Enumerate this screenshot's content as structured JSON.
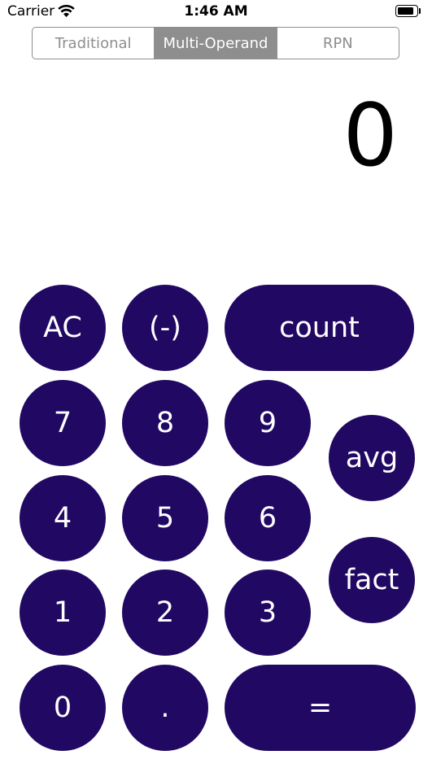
{
  "status_bar": {
    "carrier": "Carrier",
    "time": "1:46 AM",
    "wifi_icon": "wifi-icon",
    "battery_icon": "battery-icon"
  },
  "mode_selector": {
    "segments": [
      {
        "label": "Traditional",
        "selected": false
      },
      {
        "label": "Multi-Operand",
        "selected": true
      },
      {
        "label": "RPN",
        "selected": false
      }
    ]
  },
  "display": {
    "value": "0"
  },
  "keys": {
    "ac": "AC",
    "negate": "(-)",
    "count": "count",
    "seven": "7",
    "eight": "8",
    "nine": "9",
    "avg": "avg",
    "four": "4",
    "five": "5",
    "six": "6",
    "fact": "fact",
    "one": "1",
    "two": "2",
    "three": "3",
    "zero": "0",
    "decimal": ".",
    "equals": "="
  },
  "colors": {
    "key_background": "#210963",
    "key_text": "#ffffff",
    "segment_tint": "#8e8e8e"
  }
}
